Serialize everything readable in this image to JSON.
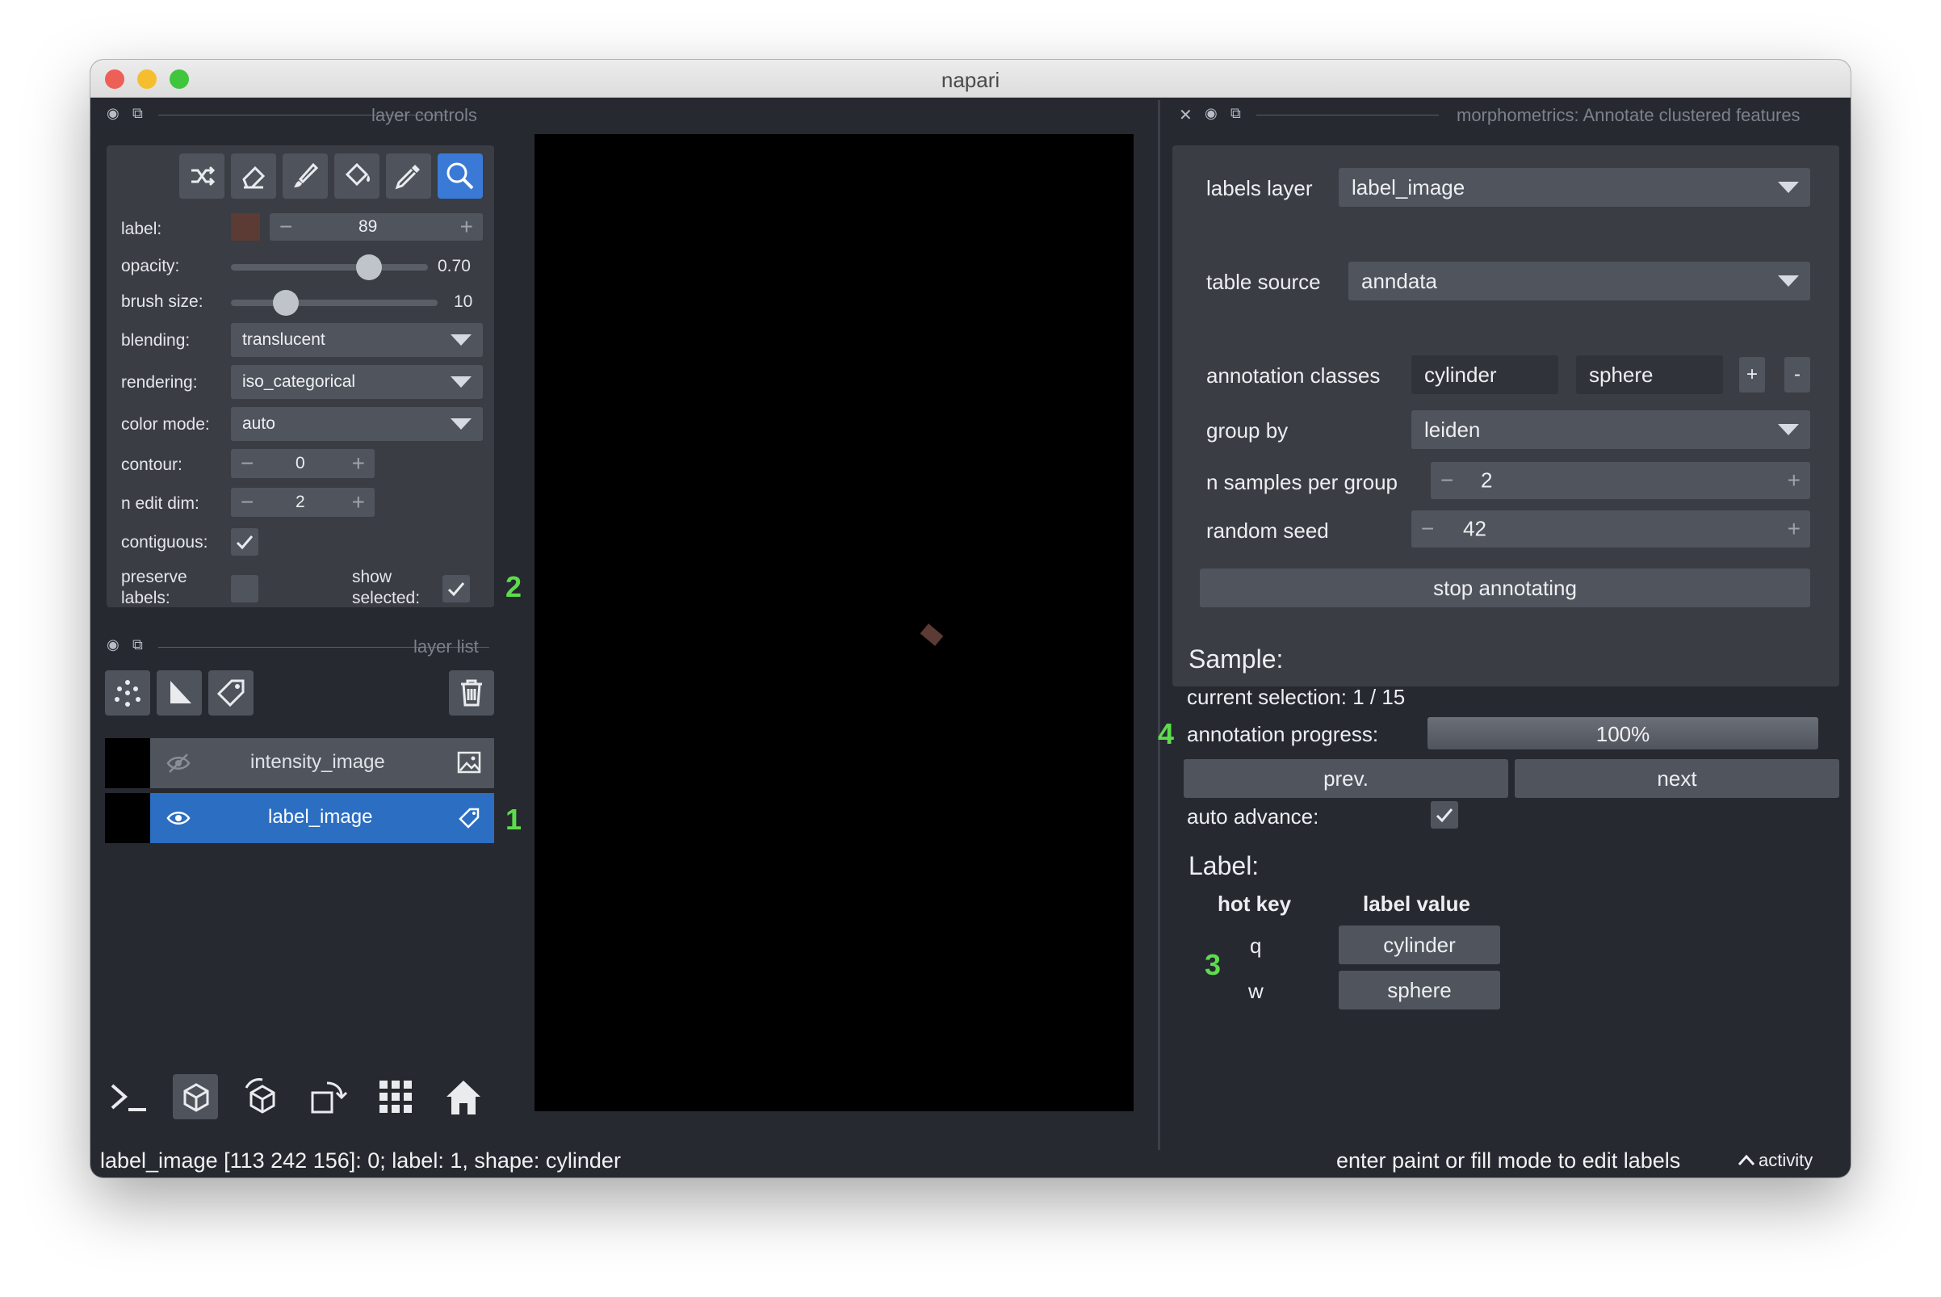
{
  "window": {
    "title": "napari"
  },
  "layer_controls": {
    "header": "layer controls",
    "label_label": "label:",
    "label_value": "89",
    "label_color": "#5b3b33",
    "opacity_label": "opacity:",
    "opacity_value": "0.70",
    "opacity_fraction": 0.7,
    "brush_label": "brush size:",
    "brush_value": "10",
    "blending_label": "blending:",
    "blending_value": "translucent",
    "rendering_label": "rendering:",
    "rendering_value": "iso_categorical",
    "color_mode_label": "color mode:",
    "color_mode_value": "auto",
    "contour_label": "contour:",
    "contour_value": "0",
    "n_edit_dim_label": "n edit dim:",
    "n_edit_dim_value": "2",
    "contiguous_label": "contiguous:",
    "preserve_label_1": "preserve",
    "preserve_label_2": "labels:",
    "show_selected_1": "show",
    "show_selected_2": "selected:",
    "tools": [
      "shuffle-icon",
      "eraser-icon",
      "paintbrush-icon",
      "fill-bucket-icon",
      "eyedropper-icon",
      "zoom-icon"
    ],
    "active_tool": "zoom-icon"
  },
  "layer_list": {
    "header": "layer list",
    "layers": [
      {
        "name": "intensity_image",
        "visible": false,
        "type_icon": "image-icon"
      },
      {
        "name": "label_image",
        "visible": true,
        "selected": true,
        "type_icon": "label-tag-icon"
      }
    ]
  },
  "annotations": {
    "one": "1",
    "two": "2",
    "three": "3",
    "four": "4"
  },
  "plugin": {
    "header": "morphometrics: Annotate clustered features",
    "labels_layer_label": "labels layer",
    "labels_layer_value": "label_image",
    "table_source_label": "table source",
    "table_source_value": "anndata",
    "annotation_classes_label": "annotation classes",
    "classes": [
      "cylinder",
      "sphere"
    ],
    "add_class": "+",
    "remove_class": "-",
    "group_by_label": "group by",
    "group_by_value": "leiden",
    "n_samples_label": "n samples per group",
    "n_samples_value": "2",
    "random_seed_label": "random seed",
    "random_seed_value": "42",
    "stop_button": "stop annotating",
    "sample_heading": "Sample:",
    "current_selection": "current selection: 1 / 15",
    "progress_label": "annotation progress:",
    "progress_text": "100%",
    "progress_fraction": 1.0,
    "prev_button": "prev.",
    "next_button": "next",
    "auto_advance_label": "auto advance:",
    "label_heading": "Label:",
    "hotkey_header": "hot key",
    "label_value_header": "label value",
    "hotkeys": [
      {
        "key": "q",
        "value": "cylinder"
      },
      {
        "key": "w",
        "value": "sphere"
      }
    ]
  },
  "status": {
    "left": "label_image [113 242 156]: 0; label: 1, shape: cylinder",
    "right": "enter paint or fill mode to edit labels",
    "activity": "activity"
  },
  "colors": {
    "background": "#262930",
    "panel": "#3a3d44",
    "selected": "#2c6ec2",
    "accent": "#3a7ad6",
    "annotation": "#5ddc4c"
  }
}
